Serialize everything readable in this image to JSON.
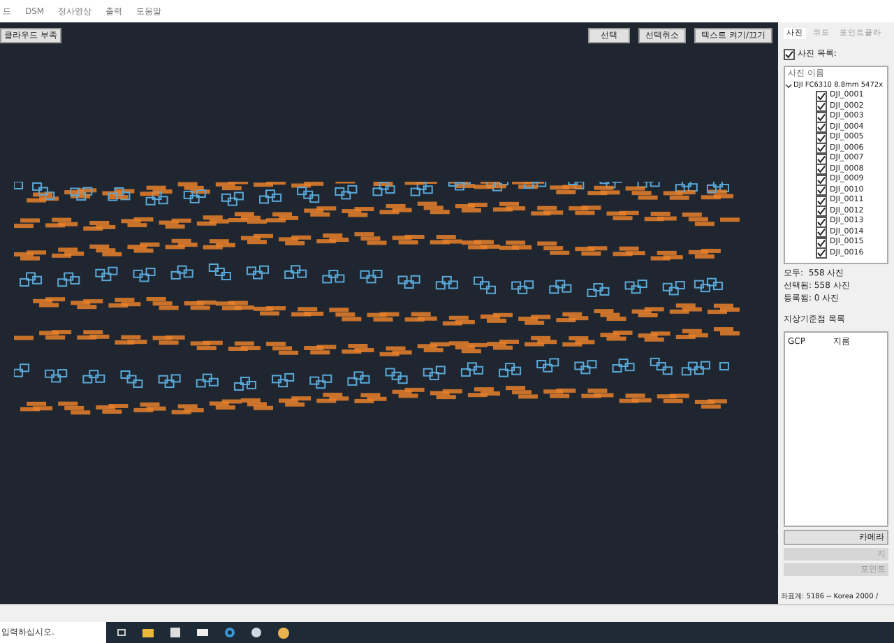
{
  "menu": [
    "드",
    "DSM",
    "정사영상",
    "출력",
    "도움말"
  ],
  "canvas": {
    "toggle_button": "클라우드 부족",
    "buttons": [
      "선택",
      "선택취소",
      "텍스트 켜기/끄기"
    ]
  },
  "panel": {
    "tabs": [
      {
        "label": "사진",
        "selected": true
      },
      {
        "label": "위드",
        "selected": false
      },
      {
        "label": "포인트클라",
        "selected": false
      }
    ],
    "photo_list": {
      "label": "사진 목록:",
      "checked": true,
      "header": "사진 이름",
      "group": {
        "label": "DJI FC6310 8.8mm 5472x",
        "expanded": true,
        "children": [
          {
            "label": "DJI_0001",
            "checked": true
          },
          {
            "label": "DJI_0002",
            "checked": true
          },
          {
            "label": "DJI_0003",
            "checked": true
          },
          {
            "label": "DJI_0004",
            "checked": true
          },
          {
            "label": "DJI_0005",
            "checked": true
          },
          {
            "label": "DJI_0006",
            "checked": true
          },
          {
            "label": "DJI_0007",
            "checked": true
          },
          {
            "label": "DJI_0008",
            "checked": true
          },
          {
            "label": "DJI_0009",
            "checked": true
          },
          {
            "label": "DJI_0010",
            "checked": true
          },
          {
            "label": "DJI_0011",
            "checked": true
          },
          {
            "label": "DJI_0012",
            "checked": true
          },
          {
            "label": "DJI_0013",
            "checked": true
          },
          {
            "label": "DJI_0014",
            "checked": true
          },
          {
            "label": "DJI_0015",
            "checked": true
          },
          {
            "label": "DJI_0016",
            "checked": true
          }
        ]
      }
    },
    "stats": [
      "모두:  558 사진",
      "선택됨: 558 사진",
      "등록됨: 0 사진"
    ],
    "gcp_title": "지상기준점 목록",
    "gcp_columns": [
      "GCP",
      "지름"
    ],
    "buttons": [
      {
        "label": "카메라",
        "disabled": false
      },
      {
        "label": "지",
        "disabled": true
      },
      {
        "label": "포인트",
        "disabled": true
      }
    ],
    "status": "좌표계: 5186 -- Korea 2000 /"
  },
  "taskbar": {
    "search_placeholder": "입력하십시오."
  }
}
